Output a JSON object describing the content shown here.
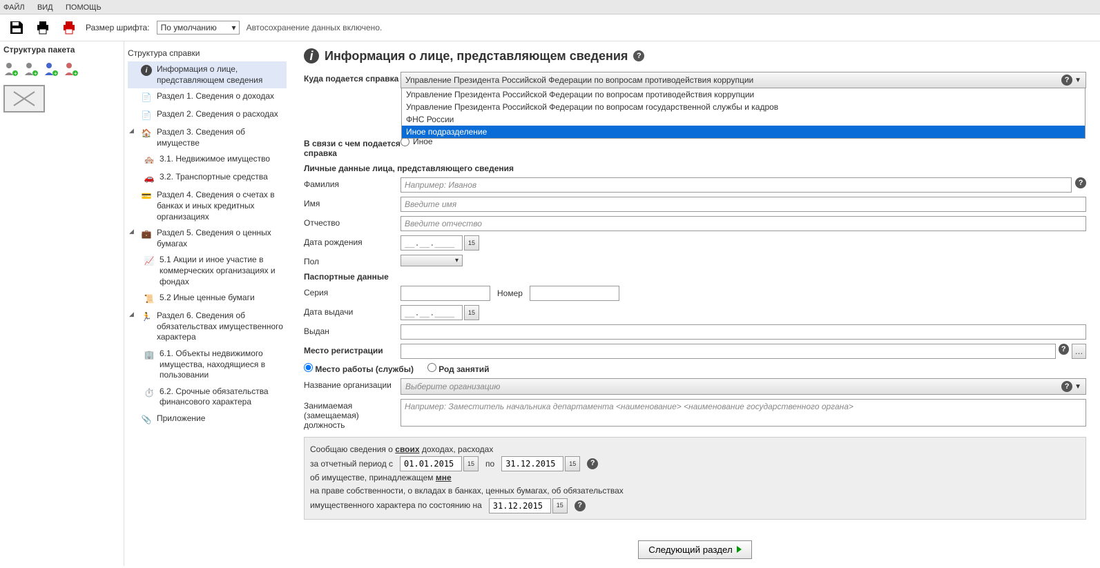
{
  "menu": {
    "file": "ФАЙЛ",
    "view": "ВИД",
    "help": "ПОМОЩЬ"
  },
  "toolbar": {
    "font_label": "Размер шрифта:",
    "font_value": "По умолчанию",
    "autosave": "Автосохранение данных включено."
  },
  "left": {
    "title": "Структура пакета"
  },
  "tree": {
    "title": "Структура справки",
    "items": [
      {
        "label": "Информация о лице, представляющем сведения"
      },
      {
        "label": "Раздел 1. Сведения о доходах"
      },
      {
        "label": "Раздел 2. Сведения о расходах"
      },
      {
        "label": "Раздел 3. Сведения об имуществе"
      },
      {
        "label": "3.1. Недвижимое имущество"
      },
      {
        "label": "3.2. Транспортные средства"
      },
      {
        "label": "Раздел 4. Сведения о счетах в банках и иных кредитных организациях"
      },
      {
        "label": "Раздел 5. Сведения о ценных бумагах"
      },
      {
        "label": "5.1 Акции и иное участие в коммерческих организациях и фондах"
      },
      {
        "label": "5.2 Иные ценные бумаги"
      },
      {
        "label": "Раздел 6. Сведения об обязательствах имущественного характера"
      },
      {
        "label": "6.1. Объекты недвижимого имущества, находящиеся в пользовании"
      },
      {
        "label": "6.2. Срочные обязательства финансового характера"
      },
      {
        "label": "Приложение"
      }
    ]
  },
  "page": {
    "title": "Информация о лице, представляющем сведения"
  },
  "form": {
    "dest_label": "Куда подается справка",
    "dest_value": "Управление Президента Российской Федерации по вопросам противодействия коррупции",
    "dest_options": [
      "Управление Президента Российской Федерации по вопросам противодействия коррупции",
      "Управление Президента Российской Федерации по вопросам государственной службы и кадров",
      "ФНС России",
      "Иное подразделение"
    ],
    "reason_label": "В связи с чем подается справка",
    "reason_other": "Иное",
    "personal_head": "Личные данные лица, представляющего сведения",
    "lastname_label": "Фамилия",
    "lastname_ph": "Например: Иванов",
    "firstname_label": "Имя",
    "firstname_ph": "Введите имя",
    "patronym_label": "Отчество",
    "patronym_ph": "Введите отчество",
    "dob_label": "Дата рождения",
    "date_mask": "__.__.____",
    "gender_label": "Пол",
    "passport_head": "Паспортные данные",
    "series_label": "Серия",
    "number_label": "Номер",
    "issued_date_label": "Дата выдачи",
    "issued_by_label": "Выдан",
    "reg_label": "Место регистрации",
    "work_radio": "Место работы (службы)",
    "occupation_radio": "Род занятий",
    "org_label": "Название организации",
    "org_ph": "Выберите организацию",
    "position_label": "Занимаемая (замещаемая) должность",
    "position_ph": "Например: Заместитель начальника департамента <наименование> <наименование государственного органа>"
  },
  "summary": {
    "line1a": "Сообщаю сведения о ",
    "line1u": "своих",
    "line1b": " доходах, расходах",
    "line2a": "за отчетный период с",
    "date_from": "01.01.2015",
    "line2b": "по",
    "date_to": "31.12.2015",
    "line3a": "об имуществе, принадлежащем ",
    "line3u": "мне",
    "line4": "на праве собственности, о вкладах в банках, ценных бумагах, об обязательствах",
    "line5": "имущественного характера по состоянию на",
    "date_asof": "31.12.2015"
  },
  "next_btn": "Следующий раздел"
}
